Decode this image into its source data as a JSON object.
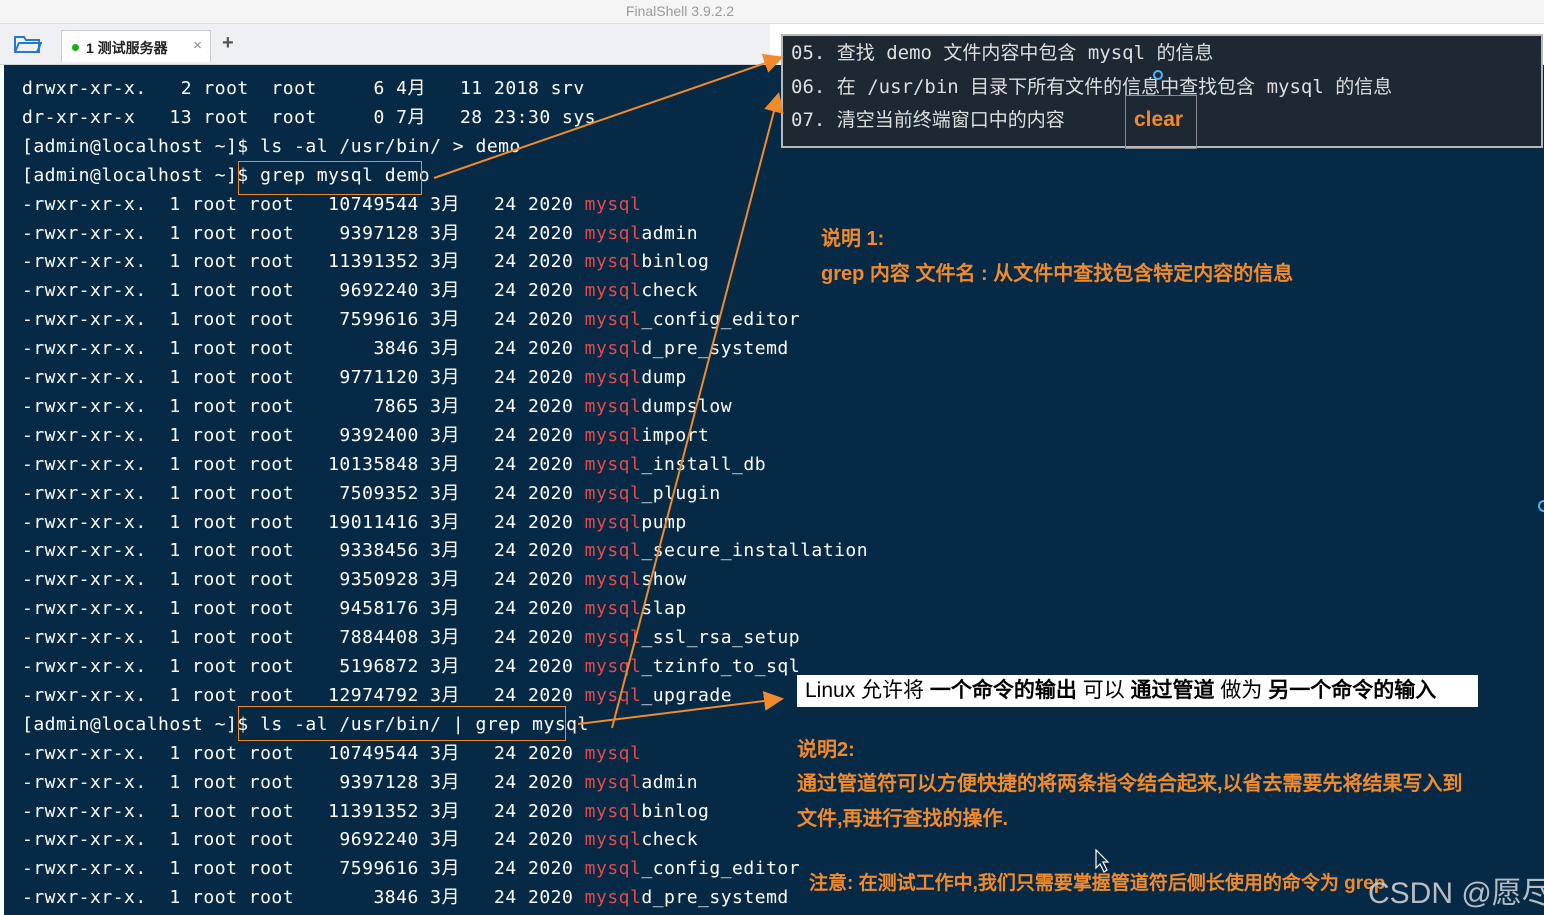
{
  "window": {
    "title": "FinalShell 3.9.2.2"
  },
  "tabs": [
    {
      "label": "1 测试服务器"
    }
  ],
  "terminal": {
    "lines": [
      {
        "pre": "drwxr-xr-x.   2 root  root     6 4月   11 2018 srv",
        "hl": "",
        "post": ""
      },
      {
        "pre": "dr-xr-xr-x   13 root  root     0 7月   28 23:30 sys",
        "hl": "",
        "post": ""
      },
      {
        "pre": "[admin@localhost ~]$ ls -al /usr/bin/ > demo",
        "hl": "",
        "post": ""
      },
      {
        "pre": "[admin@localhost ~]$ grep mysql demo",
        "hl": "",
        "post": ""
      },
      {
        "pre": "-rwxr-xr-x.  1 root root   10749544 3月   24 2020 ",
        "hl": "mysql",
        "post": ""
      },
      {
        "pre": "-rwxr-xr-x.  1 root root    9397128 3月   24 2020 ",
        "hl": "mysql",
        "post": "admin"
      },
      {
        "pre": "-rwxr-xr-x.  1 root root   11391352 3月   24 2020 ",
        "hl": "mysql",
        "post": "binlog"
      },
      {
        "pre": "-rwxr-xr-x.  1 root root    9692240 3月   24 2020 ",
        "hl": "mysql",
        "post": "check"
      },
      {
        "pre": "-rwxr-xr-x.  1 root root    7599616 3月   24 2020 ",
        "hl": "mysql",
        "post": "_config_editor"
      },
      {
        "pre": "-rwxr-xr-x.  1 root root       3846 3月   24 2020 ",
        "hl": "mysql",
        "post": "d_pre_systemd"
      },
      {
        "pre": "-rwxr-xr-x.  1 root root    9771120 3月   24 2020 ",
        "hl": "mysql",
        "post": "dump"
      },
      {
        "pre": "-rwxr-xr-x.  1 root root       7865 3月   24 2020 ",
        "hl": "mysql",
        "post": "dumpslow"
      },
      {
        "pre": "-rwxr-xr-x.  1 root root    9392400 3月   24 2020 ",
        "hl": "mysql",
        "post": "import"
      },
      {
        "pre": "-rwxr-xr-x.  1 root root   10135848 3月   24 2020 ",
        "hl": "mysql",
        "post": "_install_db"
      },
      {
        "pre": "-rwxr-xr-x.  1 root root    7509352 3月   24 2020 ",
        "hl": "mysql",
        "post": "_plugin"
      },
      {
        "pre": "-rwxr-xr-x.  1 root root   19011416 3月   24 2020 ",
        "hl": "mysql",
        "post": "pump"
      },
      {
        "pre": "-rwxr-xr-x.  1 root root    9338456 3月   24 2020 ",
        "hl": "mysql",
        "post": "_secure_installation"
      },
      {
        "pre": "-rwxr-xr-x.  1 root root    9350928 3月   24 2020 ",
        "hl": "mysql",
        "post": "show"
      },
      {
        "pre": "-rwxr-xr-x.  1 root root    9458176 3月   24 2020 ",
        "hl": "mysql",
        "post": "slap"
      },
      {
        "pre": "-rwxr-xr-x.  1 root root    7884408 3月   24 2020 ",
        "hl": "mysql",
        "post": "_ssl_rsa_setup"
      },
      {
        "pre": "-rwxr-xr-x.  1 root root    5196872 3月   24 2020 ",
        "hl": "mysql",
        "post": "_tzinfo_to_sql"
      },
      {
        "pre": "-rwxr-xr-x.  1 root root   12974792 3月   24 2020 ",
        "hl": "mysql",
        "post": "_upgrade"
      },
      {
        "pre": "[admin@localhost ~]$ ls -al /usr/bin/ | grep mysql",
        "hl": "",
        "post": ""
      },
      {
        "pre": "-rwxr-xr-x.  1 root root   10749544 3月   24 2020 ",
        "hl": "mysql",
        "post": ""
      },
      {
        "pre": "-rwxr-xr-x.  1 root root    9397128 3月   24 2020 ",
        "hl": "mysql",
        "post": "admin"
      },
      {
        "pre": "-rwxr-xr-x.  1 root root   11391352 3月   24 2020 ",
        "hl": "mysql",
        "post": "binlog"
      },
      {
        "pre": "-rwxr-xr-x.  1 root root    9692240 3月   24 2020 ",
        "hl": "mysql",
        "post": "check"
      },
      {
        "pre": "-rwxr-xr-x.  1 root root    7599616 3月   24 2020 ",
        "hl": "mysql",
        "post": "_config_editor"
      },
      {
        "pre": "-rwxr-xr-x.  1 root root       3846 3月   24 2020 ",
        "hl": "mysql",
        "post": "d_pre_systemd"
      }
    ]
  },
  "notes_panel": {
    "line5": "05. 查找 demo 文件内容中包含 mysql 的信息",
    "line6": "06. 在 /usr/bin 目录下所有文件的信息中查找包含 mysql 的信息",
    "line7": "07. 清空当前终端窗口中的内容",
    "clear_label": "clear"
  },
  "annotations": {
    "note1_title": "说明 1:",
    "note1_body": "grep 内容 文件名 : 从文件中查找包含特定内容的信息",
    "pipe_banner": {
      "p1": "Linux 允许将 ",
      "b1": "一个命令的输出",
      "p2": " 可以 ",
      "b2": "通过管道",
      "p3": " 做为 ",
      "b3": "另一个命令的输入"
    },
    "note2_title": "说明2:",
    "note2_line1": "通过管道符可以方便快捷的将两条指令结合起来,以省去需要先将结果写入到",
    "note2_line2": "文件,再进行查找的操作.",
    "note3": "注意: 在测试工作中,我们只需要掌握管道符后侧长使用的命令为 grep"
  },
  "watermark": "CSDN @愿尽",
  "colors": {
    "terminal_bg": "#062a45",
    "accent_orange": "#f08a2c",
    "match_red": "#e34b4b"
  }
}
